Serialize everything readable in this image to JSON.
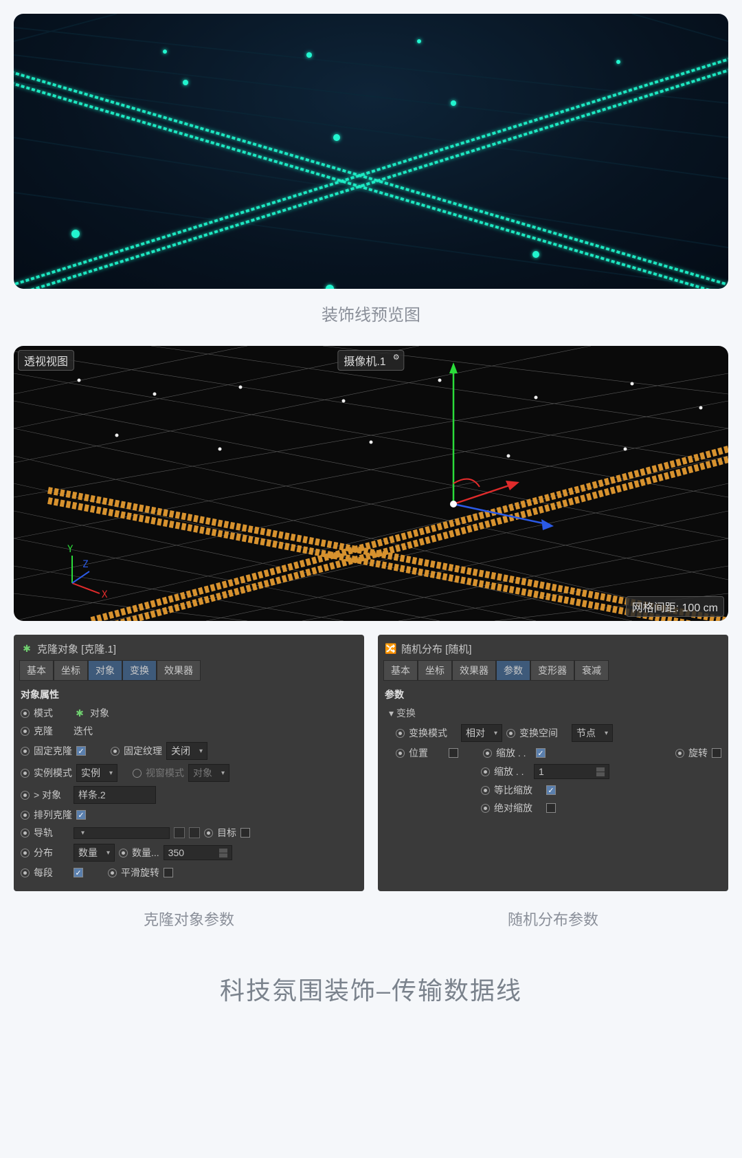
{
  "preview": {
    "caption": "装饰线预览图"
  },
  "viewport": {
    "view_label": "透视视图",
    "camera_label": "摄像机.1",
    "grid_label": "网格间距: 100 cm",
    "axes": {
      "x": "X",
      "y": "Y",
      "z": "Z"
    }
  },
  "clone_panel": {
    "title": "克隆对象 [克隆.1]",
    "tabs": [
      "基本",
      "坐标",
      "对象",
      "变换",
      "效果器"
    ],
    "active_tab": 2,
    "section": "对象属性",
    "rows": {
      "mode_label": "模式",
      "mode_value": "对象",
      "clone_label": "克隆",
      "clone_value": "迭代",
      "fixed_clone": "固定克隆",
      "fixed_texture": "固定纹理",
      "fixed_texture_value": "关闭",
      "instance_mode": "实例模式",
      "instance_mode_value": "实例",
      "view_mode": "视窗模式",
      "view_mode_value": "对象",
      "object_label": "> 对象",
      "object_value": "样条.2",
      "array_clone": "排列克隆",
      "rail": "导轨",
      "target": "目标",
      "distribute": "分布",
      "distribute_value": "数量",
      "count_label": "数量...",
      "count_value": "350",
      "per_seg": "每段",
      "smooth_rotate": "平滑旋转"
    }
  },
  "random_panel": {
    "title": "随机分布 [随机]",
    "tabs": [
      "基本",
      "坐标",
      "效果器",
      "参数",
      "变形器",
      "衰减"
    ],
    "active_tab": 3,
    "section": "参数",
    "subsection": "▾ 变换",
    "rows": {
      "transform_mode": "变换模式",
      "transform_mode_value": "相对",
      "transform_space": "变换空间",
      "transform_space_value": "节点",
      "position": "位置",
      "scale": "缩放 . .",
      "rotate": "旋转",
      "scale2": "缩放 . .",
      "scale2_value": "1",
      "uniform_scale": "等比缩放",
      "absolute_scale": "绝对缩放"
    }
  },
  "captions": {
    "clone": "克隆对象参数",
    "random": "随机分布参数"
  },
  "big_title": "科技氛围装饰–传输数据线"
}
